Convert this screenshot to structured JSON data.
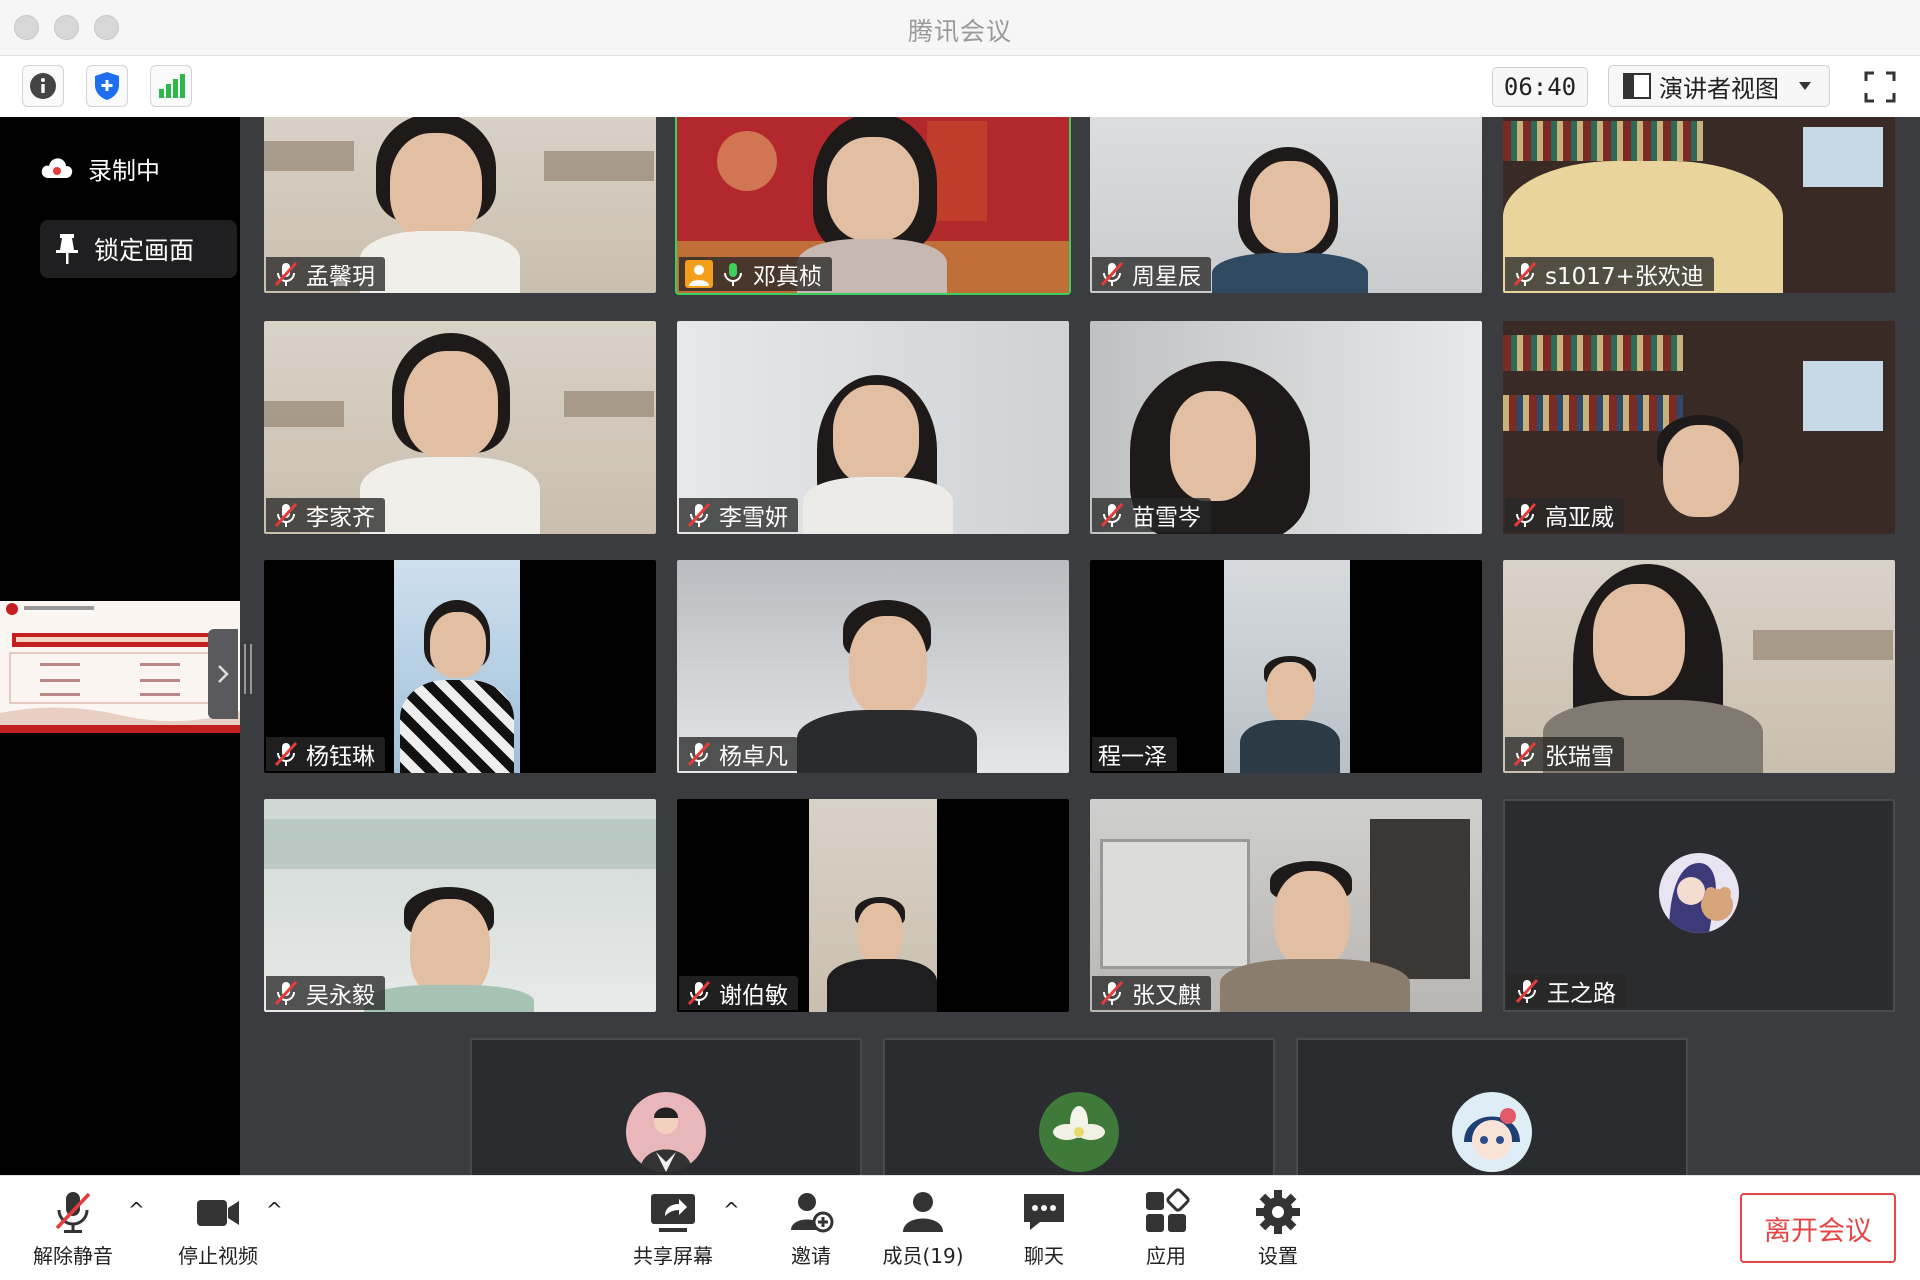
{
  "window": {
    "title": "腾讯会议"
  },
  "toolbar": {
    "timer": "06:40",
    "view_mode": "演讲者视图"
  },
  "sidebar": {
    "recording_label": "录制中",
    "lock_label": "锁定画面"
  },
  "participants": [
    {
      "name": "孟馨玥",
      "muted": true,
      "video": true
    },
    {
      "name": "邓真桢",
      "muted": false,
      "video": true,
      "active_speaker": true
    },
    {
      "name": "周星辰",
      "muted": true,
      "video": true
    },
    {
      "name": "s1017+张欢迪",
      "muted": true,
      "video": true
    },
    {
      "name": "李家齐",
      "muted": true,
      "video": true
    },
    {
      "name": "李雪妍",
      "muted": true,
      "video": true
    },
    {
      "name": "苗雪岑",
      "muted": true,
      "video": true
    },
    {
      "name": "高亚威",
      "muted": true,
      "video": true
    },
    {
      "name": "杨钰琳",
      "muted": true,
      "video": true
    },
    {
      "name": "杨卓凡",
      "muted": true,
      "video": true
    },
    {
      "name": "程一泽",
      "muted": false,
      "video": true
    },
    {
      "name": "张瑞雪",
      "muted": true,
      "video": true
    },
    {
      "name": "吴永毅",
      "muted": true,
      "video": true
    },
    {
      "name": "谢伯敏",
      "muted": true,
      "video": true
    },
    {
      "name": "张又麒",
      "muted": true,
      "video": true
    },
    {
      "name": "王之路",
      "muted": true,
      "video": false
    }
  ],
  "controls": {
    "unmute": "解除静音",
    "stop_video": "停止视频",
    "share_screen": "共享屏幕",
    "invite": "邀请",
    "members": "成员(19)",
    "chat": "聊天",
    "apps": "应用",
    "settings": "设置",
    "leave": "离开会议"
  },
  "colors": {
    "active_border": "#3fce5b",
    "leave_red": "#e54545",
    "stage_bg": "#3b3c40"
  }
}
